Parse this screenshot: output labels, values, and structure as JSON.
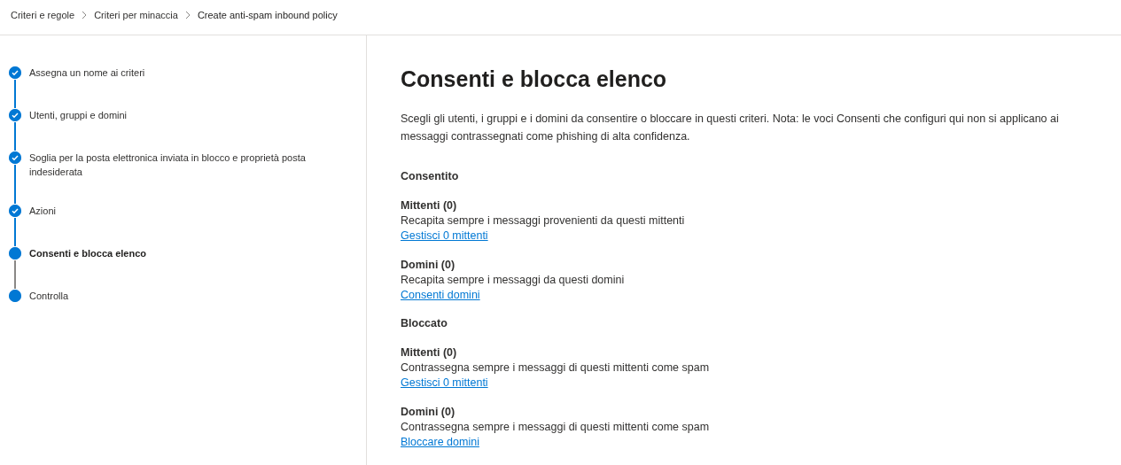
{
  "breadcrumb": [
    "Criteri e regole",
    "Criteri per minaccia",
    "Create anti-spam inbound policy"
  ],
  "steps": [
    {
      "label": "Assegna un nome ai criteri",
      "completed": true,
      "selected": false
    },
    {
      "label": "Utenti, gruppi e domini",
      "completed": true,
      "selected": false
    },
    {
      "label": "Soglia per la posta elettronica inviata in blocco e proprietà posta indesiderata",
      "completed": true,
      "selected": false
    },
    {
      "label": "Azioni",
      "completed": true,
      "selected": false
    },
    {
      "label": "Consenti e blocca elenco",
      "completed": false,
      "selected": true
    },
    {
      "label": "Controlla",
      "completed": false,
      "selected": false
    }
  ],
  "page": {
    "title": "Consenti e blocca elenco",
    "description": "Scegli gli utenti, i gruppi e i domini da consentire o bloccare in questi criteri. Nota: le voci Consenti che configuri qui non si applicano ai messaggi contrassegnati come phishing di alta confidenza.",
    "groups": [
      {
        "heading": "Consentito",
        "items": [
          {
            "title": "Mittenti (0)",
            "description": "Recapita sempre i messaggi provenienti da questi mittenti",
            "link": "Gestisci 0 mittenti"
          },
          {
            "title": "Domini (0)",
            "description": "Recapita sempre i messaggi da questi domini",
            "link": "Consenti domini"
          }
        ]
      },
      {
        "heading": "Bloccato",
        "items": [
          {
            "title": "Mittenti (0)",
            "description": "Contrassegna sempre i messaggi di questi mittenti come spam",
            "link": "Gestisci 0 mittenti"
          },
          {
            "title": "Domini (0)",
            "description": "Contrassegna sempre i messaggi di questi mittenti come spam",
            "link": "Bloccare domini"
          }
        ]
      }
    ]
  }
}
